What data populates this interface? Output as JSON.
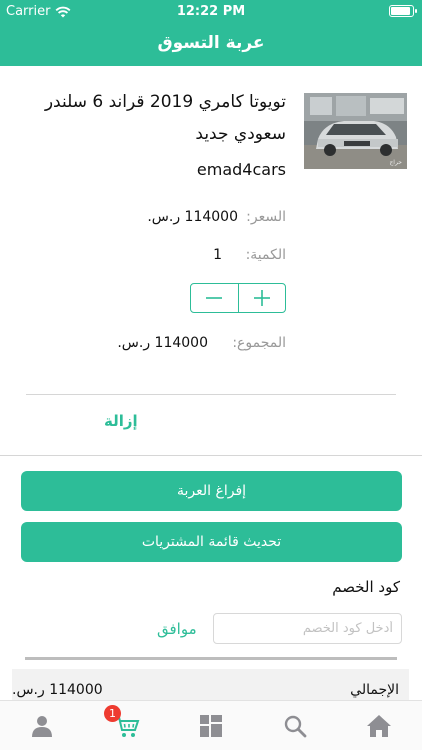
{
  "status_bar": {
    "carrier": "Carrier",
    "time": "12:22 PM"
  },
  "nav": {
    "title": "عربة التسوق"
  },
  "product": {
    "title": "تويوتا كامري 2019 قراند 6 سلندر سعودي جديد",
    "seller": "emad4cars",
    "image_watermark": "حراج",
    "price_label": "السعر:",
    "price_value": "114000 ر.س.",
    "quantity_label": "الكمية:",
    "quantity_value": "1",
    "subtotal_label": "المجموع:",
    "subtotal_value": "114000 ر.س.",
    "remove_label": "إزالة"
  },
  "actions": {
    "empty_cart_label": "إفراغ العربة",
    "update_cart_label": "تحديث قائمة المشتريات"
  },
  "coupon": {
    "label": "كود الخصم",
    "placeholder": "أدخل كود الخصم",
    "apply_label": "موافق"
  },
  "totals": {
    "total_label": "الإجمالي",
    "total_value": "114000 ر.س."
  },
  "tab_bar": {
    "cart_badge": "1",
    "tabs": [
      "profile-icon",
      "cart-icon",
      "categories-icon",
      "search-icon",
      "home-icon"
    ]
  },
  "colors": {
    "accent": "#2dbd98",
    "badge": "#ee3b30"
  }
}
